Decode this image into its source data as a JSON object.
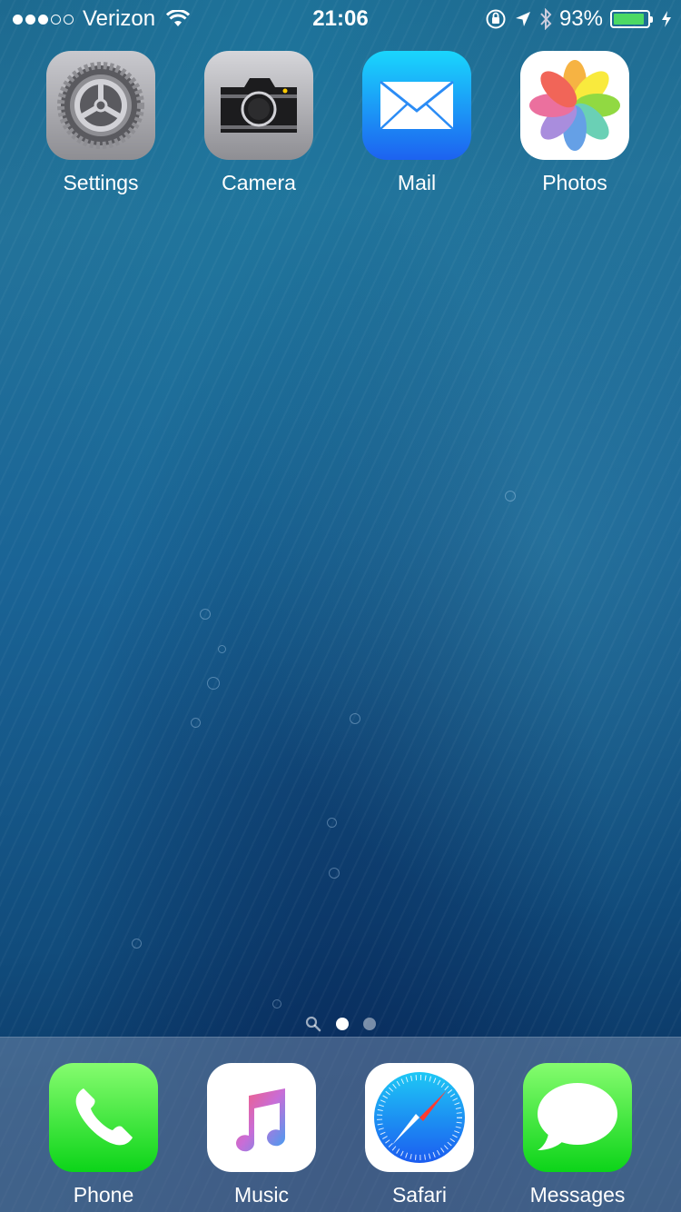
{
  "status_bar": {
    "carrier": "Verizon",
    "time": "21:06",
    "battery_percent": "93%",
    "battery_level": 0.93,
    "battery_color": "#4cd964",
    "signal_bars_filled": 3,
    "signal_bars_total": 5,
    "icons": [
      "wifi-icon",
      "orientation-lock-icon",
      "location-icon",
      "bluetooth-icon",
      "charging-icon"
    ]
  },
  "home_apps": [
    {
      "label": "Settings",
      "icon": "gear-icon"
    },
    {
      "label": "Camera",
      "icon": "camera-icon"
    },
    {
      "label": "Mail",
      "icon": "envelope-icon"
    },
    {
      "label": "Photos",
      "icon": "flower-icon"
    }
  ],
  "page_indicator": {
    "pages": 2,
    "current": 1,
    "has_search_page": true
  },
  "dock_apps": [
    {
      "label": "Phone",
      "icon": "phone-handset-icon"
    },
    {
      "label": "Music",
      "icon": "music-note-icon"
    },
    {
      "label": "Safari",
      "icon": "compass-icon"
    },
    {
      "label": "Messages",
      "icon": "speech-bubble-icon"
    }
  ]
}
